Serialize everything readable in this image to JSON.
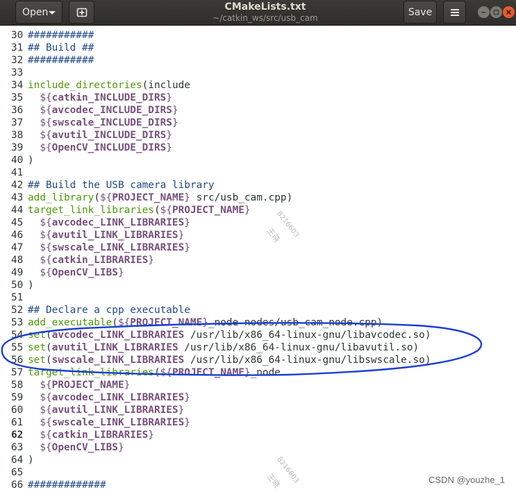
{
  "header": {
    "open_label": "Open",
    "save_label": "Save",
    "title": "CMakeLists.txt",
    "subtitle": "~/catkin_ws/src/usb_cam"
  },
  "editor": {
    "lines": [
      {
        "n": "30",
        "t": [
          [
            "comment",
            "###########"
          ]
        ]
      },
      {
        "n": "31",
        "t": [
          [
            "comment",
            "## Build ##"
          ]
        ]
      },
      {
        "n": "32",
        "t": [
          [
            "comment",
            "###########"
          ]
        ]
      },
      {
        "n": "33",
        "t": []
      },
      {
        "n": "34",
        "t": [
          [
            "func",
            "include_directories"
          ],
          [
            "paren",
            "("
          ],
          [
            "plain",
            "include"
          ]
        ]
      },
      {
        "n": "35",
        "t": [
          [
            "plain",
            "  "
          ],
          [
            "varw",
            "${"
          ],
          [
            "varn",
            "catkin_INCLUDE_DIRS"
          ],
          [
            "varw",
            "}"
          ]
        ]
      },
      {
        "n": "36",
        "t": [
          [
            "plain",
            "  "
          ],
          [
            "varw",
            "${"
          ],
          [
            "varn",
            "avcodec_INCLUDE_DIRS"
          ],
          [
            "varw",
            "}"
          ]
        ]
      },
      {
        "n": "37",
        "t": [
          [
            "plain",
            "  "
          ],
          [
            "varw",
            "${"
          ],
          [
            "varn",
            "swscale_INCLUDE_DIRS"
          ],
          [
            "varw",
            "}"
          ]
        ]
      },
      {
        "n": "38",
        "t": [
          [
            "plain",
            "  "
          ],
          [
            "varw",
            "${"
          ],
          [
            "varn",
            "avutil_INCLUDE_DIRS"
          ],
          [
            "varw",
            "}"
          ]
        ]
      },
      {
        "n": "39",
        "t": [
          [
            "plain",
            "  "
          ],
          [
            "varw",
            "${"
          ],
          [
            "varn",
            "OpenCV_INCLUDE_DIRS"
          ],
          [
            "varw",
            "}"
          ]
        ]
      },
      {
        "n": "40",
        "t": [
          [
            "paren",
            ")"
          ]
        ]
      },
      {
        "n": "41",
        "t": []
      },
      {
        "n": "42",
        "t": [
          [
            "comment",
            "## Build the USB camera library"
          ]
        ]
      },
      {
        "n": "43",
        "t": [
          [
            "func",
            "add_library"
          ],
          [
            "paren",
            "("
          ],
          [
            "varw",
            "${"
          ],
          [
            "varn",
            "PROJECT_NAME"
          ],
          [
            "varw",
            "}"
          ],
          [
            "plain",
            " src/usb_cam.cpp)"
          ]
        ]
      },
      {
        "n": "44",
        "t": [
          [
            "func",
            "target_link_libraries"
          ],
          [
            "paren",
            "("
          ],
          [
            "varw",
            "${"
          ],
          [
            "varn",
            "PROJECT_NAME"
          ],
          [
            "varw",
            "}"
          ]
        ]
      },
      {
        "n": "45",
        "t": [
          [
            "plain",
            "  "
          ],
          [
            "varw",
            "${"
          ],
          [
            "varn",
            "avcodec_LINK_LIBRARIES"
          ],
          [
            "varw",
            "}"
          ]
        ]
      },
      {
        "n": "46",
        "t": [
          [
            "plain",
            "  "
          ],
          [
            "varw",
            "${"
          ],
          [
            "varn",
            "avutil_LINK_LIBRARIES"
          ],
          [
            "varw",
            "}"
          ]
        ]
      },
      {
        "n": "47",
        "t": [
          [
            "plain",
            "  "
          ],
          [
            "varw",
            "${"
          ],
          [
            "varn",
            "swscale_LINK_LIBRARIES"
          ],
          [
            "varw",
            "}"
          ]
        ]
      },
      {
        "n": "48",
        "t": [
          [
            "plain",
            "  "
          ],
          [
            "varw",
            "${"
          ],
          [
            "varn",
            "catkin_LIBRARIES"
          ],
          [
            "varw",
            "}"
          ]
        ]
      },
      {
        "n": "49",
        "t": [
          [
            "plain",
            "  "
          ],
          [
            "varw",
            "${"
          ],
          [
            "varn",
            "OpenCV_LIBS"
          ],
          [
            "varw",
            "}"
          ]
        ]
      },
      {
        "n": "50",
        "t": [
          [
            "paren",
            ")"
          ]
        ]
      },
      {
        "n": "51",
        "t": []
      },
      {
        "n": "52",
        "t": [
          [
            "comment",
            "## Declare a cpp executable"
          ]
        ]
      },
      {
        "n": "53",
        "t": [
          [
            "func",
            "add_executable"
          ],
          [
            "paren",
            "("
          ],
          [
            "varw",
            "${"
          ],
          [
            "varn",
            "PROJECT_NAME"
          ],
          [
            "varw",
            "}"
          ],
          [
            "plain",
            "_node nodes/usb_cam_node.cpp)"
          ]
        ]
      },
      {
        "n": "54",
        "t": [
          [
            "func",
            "set"
          ],
          [
            "paren",
            "("
          ],
          [
            "varn",
            "avcodec_LINK_LIBRARIES"
          ],
          [
            "plain",
            " /usr/lib/x86_64-linux-gnu/libavcodec.so)"
          ]
        ]
      },
      {
        "n": "55",
        "t": [
          [
            "func",
            "set"
          ],
          [
            "paren",
            "("
          ],
          [
            "varn",
            "avutil_LINK_LIBRARIES"
          ],
          [
            "plain",
            " /usr/lib/x86_64-linux-gnu/libavutil.so)"
          ]
        ]
      },
      {
        "n": "56",
        "t": [
          [
            "func",
            "set"
          ],
          [
            "paren",
            "("
          ],
          [
            "varn",
            "swscale_LINK_LIBRARIES"
          ],
          [
            "plain",
            " /usr/lib/x86_64-linux-gnu/libswscale.so)"
          ]
        ]
      },
      {
        "n": "57",
        "t": [
          [
            "func",
            "target_link_libraries"
          ],
          [
            "paren",
            "("
          ],
          [
            "varw",
            "${"
          ],
          [
            "varn",
            "PROJECT_NAME"
          ],
          [
            "varw",
            "}"
          ],
          [
            "plain",
            "_node"
          ]
        ]
      },
      {
        "n": "58",
        "t": [
          [
            "plain",
            "  "
          ],
          [
            "varw",
            "${"
          ],
          [
            "varn",
            "PROJECT_NAME"
          ],
          [
            "varw",
            "}"
          ]
        ]
      },
      {
        "n": "59",
        "t": [
          [
            "plain",
            "  "
          ],
          [
            "varw",
            "${"
          ],
          [
            "varn",
            "avcodec_LINK_LIBRARIES"
          ],
          [
            "varw",
            "}"
          ]
        ]
      },
      {
        "n": "60",
        "t": [
          [
            "plain",
            "  "
          ],
          [
            "varw",
            "${"
          ],
          [
            "varn",
            "avutil_LINK_LIBRARIES"
          ],
          [
            "varw",
            "}"
          ]
        ]
      },
      {
        "n": "61",
        "t": [
          [
            "plain",
            "  "
          ],
          [
            "varw",
            "${"
          ],
          [
            "varn",
            "swscale_LINK_LIBRARIES"
          ],
          [
            "varw",
            "}"
          ]
        ]
      },
      {
        "n": "62",
        "t": [
          [
            "plain",
            "  "
          ],
          [
            "varw",
            "${"
          ],
          [
            "varn",
            "catkin_LIBRARIES"
          ],
          [
            "varw",
            "}"
          ]
        ]
      },
      {
        "n": "63",
        "t": [
          [
            "plain",
            "  "
          ],
          [
            "varw",
            "${"
          ],
          [
            "varn",
            "OpenCV_LIBS"
          ],
          [
            "varw",
            "}"
          ]
        ]
      },
      {
        "n": "64",
        "t": [
          [
            "paren",
            ")"
          ]
        ]
      },
      {
        "n": "65",
        "t": []
      },
      {
        "n": "66",
        "t": [
          [
            "comment",
            "#############"
          ]
        ]
      }
    ],
    "current_line": "62"
  },
  "watermark": {
    "text1": "8216603",
    "text2": "王晓"
  },
  "csdn_credit": "CSDN @youzhe_1",
  "colors": {
    "comment": "#204a87",
    "function": "#4e9a06",
    "variable": "#75507b",
    "annotation_ink": "#1a3fd1"
  }
}
